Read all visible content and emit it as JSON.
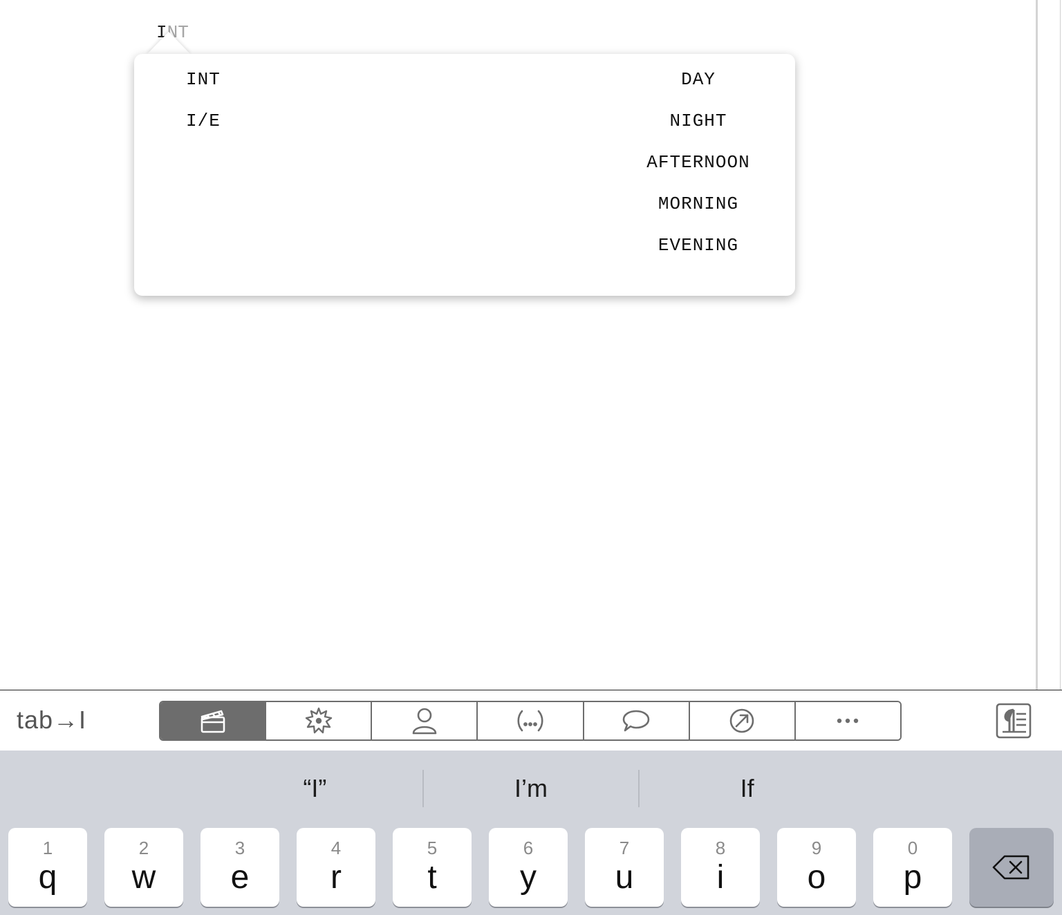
{
  "editor": {
    "typed_text": "I",
    "autocomplete_ghost": "NT"
  },
  "popover": {
    "left_options": [
      "INT",
      "I/E"
    ],
    "right_options": [
      "DAY",
      "NIGHT",
      "AFTERNOON",
      "MORNING",
      "EVENING"
    ]
  },
  "toolbar": {
    "tab_label": "tab→I",
    "segments": [
      {
        "name": "scene-heading",
        "icon": "clapperboard-icon",
        "active": true
      },
      {
        "name": "action",
        "icon": "starburst-icon",
        "active": false
      },
      {
        "name": "character",
        "icon": "person-icon",
        "active": false
      },
      {
        "name": "parenthetical",
        "icon": "parenthetical-icon",
        "active": false
      },
      {
        "name": "dialogue",
        "icon": "speech-bubble-icon",
        "active": false
      },
      {
        "name": "transition",
        "icon": "transition-icon",
        "active": false
      },
      {
        "name": "more",
        "icon": "ellipsis-icon",
        "active": false
      }
    ],
    "format_button_icon": "pilcrow-icon",
    "colors": {
      "active": "#6d6d6d",
      "border": "#6d6d6d"
    }
  },
  "keyboard": {
    "suggestions": [
      "“I”",
      "I’m",
      "If"
    ],
    "keys": [
      {
        "num": "1",
        "ch": "q"
      },
      {
        "num": "2",
        "ch": "w"
      },
      {
        "num": "3",
        "ch": "e"
      },
      {
        "num": "4",
        "ch": "r"
      },
      {
        "num": "5",
        "ch": "t"
      },
      {
        "num": "6",
        "ch": "y"
      },
      {
        "num": "7",
        "ch": "u"
      },
      {
        "num": "8",
        "ch": "i"
      },
      {
        "num": "9",
        "ch": "o"
      },
      {
        "num": "0",
        "ch": "p"
      }
    ],
    "delete_icon": "backspace-icon"
  }
}
